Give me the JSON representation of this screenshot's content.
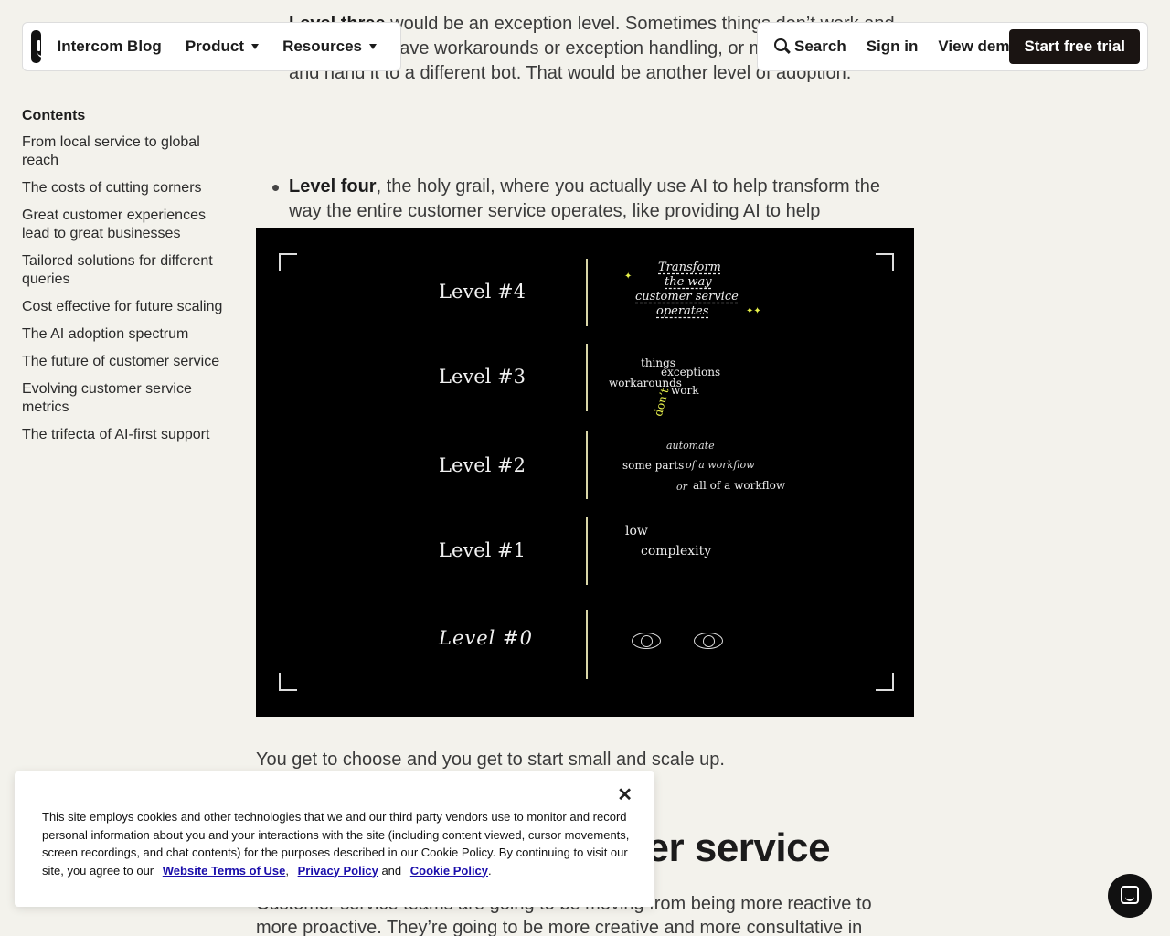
{
  "nav": {
    "brand": "Intercom Blog",
    "product": "Product",
    "resources": "Resources",
    "search": "Search",
    "sign_in": "Sign in",
    "view_demo": "View demo",
    "start_trial": "Start free trial"
  },
  "toc": {
    "title": "Contents",
    "items": [
      "From local service to global reach",
      "The costs of cutting corners",
      "Great customer experiences lead to great businesses",
      "Tailored solutions for different queries",
      "Cost effective for future scaling",
      "The AI adoption spectrum",
      "The future of customer service",
      "Evolving customer service metrics",
      "The trifecta of AI-first support"
    ]
  },
  "article": {
    "level_three_bold": "Level three",
    "level_three_text": " would be an exception level. Sometimes things don’t work and you need to have workarounds or exception handling, or maybe you take it and hand it to a different bot. That would be another level of adoption.",
    "level_four_bold": "Level four",
    "level_four_text": ", the holy grail, where you actually use AI to help transform the way the entire customer service operates, like providing AI to help personalize the customer experience at every touch point, where you can completely revolutionize the way the function operates.",
    "paragraph": "You get to choose and you get to start small and scale up.",
    "heading": "The future of customer service",
    "paragraph2": "Customer service teams are going to be moving from being more reactive to more proactive. They’re going to be more creative and more consultative in"
  },
  "figure": {
    "levels": [
      "Level #4",
      "Level #3",
      "Level #2",
      "Level #1",
      "Level #0"
    ],
    "l4": [
      "Transform",
      "the way",
      "customer service",
      "operates"
    ],
    "l3": {
      "things": "things",
      "exceptions": "exceptions",
      "workarounds": "workarounds",
      "work": "work",
      "dont": "don’t"
    },
    "l2": {
      "automate": "automate",
      "some_parts": "some parts",
      "of_a_workflow": "of a workflow",
      "or": "or",
      "all_of": "all of a workflow"
    },
    "l1": {
      "low": "low",
      "complexity": "complexity"
    }
  },
  "cookie": {
    "text": "This site employs cookies and other technologies that we and our third party vendors use to monitor and record personal information about you and your interactions with the site (including content viewed, cursor movements, screen recordings, and chat contents) for the purposes described in our Cookie Policy. By continuing to visit our site, you agree to our",
    "terms": "Website Terms of Use",
    "comma": ",",
    "privacy": "Privacy Policy",
    "and": "and",
    "cookie_policy": "Cookie Policy",
    "period": ".",
    "close": "✕"
  },
  "colors": {
    "accent": "#1a1412",
    "figure_highlight": "#e9f24d",
    "background": "#f3f2ec"
  }
}
